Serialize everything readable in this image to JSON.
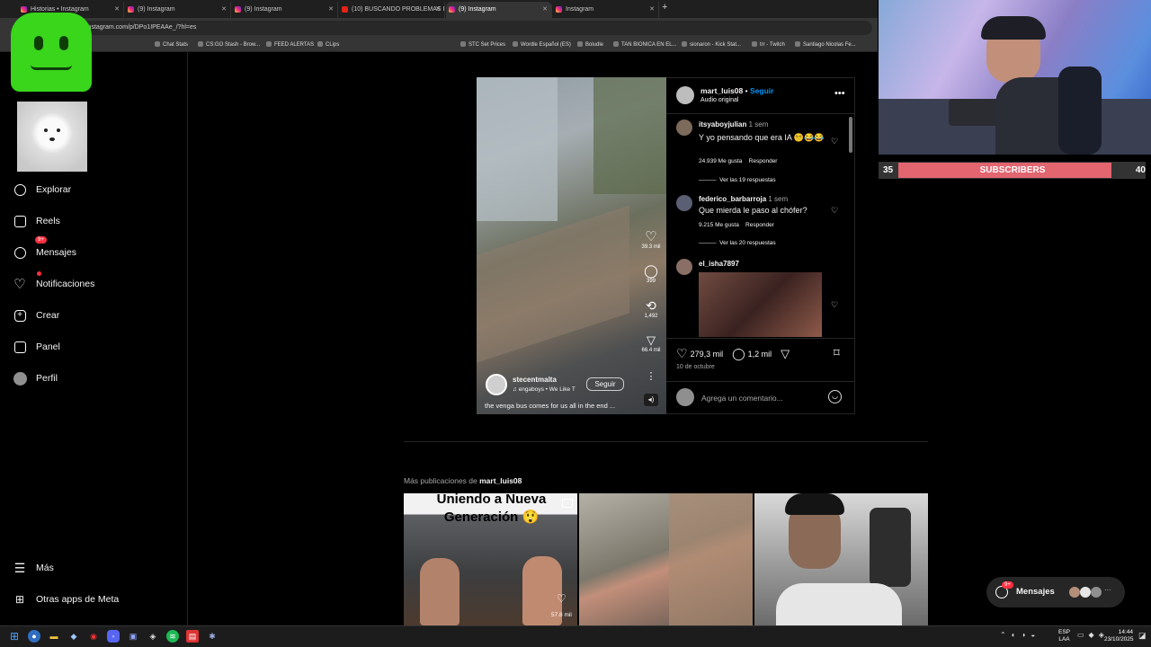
{
  "browser": {
    "tabs": [
      {
        "title": "Historias • Instagram",
        "fav": "ig"
      },
      {
        "title": "(9) Instagram",
        "fav": "ig"
      },
      {
        "title": "(9) Instagram",
        "fav": "ig"
      },
      {
        "title": "(10) BUSCANDO PROBLEMAS I",
        "fav": "yt"
      },
      {
        "title": "(9) Instagram",
        "fav": "ig"
      },
      {
        "title": "Instagram",
        "fav": "ig"
      }
    ],
    "url": "instagram.com/p/DPo1IPEAAe_/?hl=es",
    "bookmarks": [
      "Chat Stats",
      "CS:GO Stash - Brow...",
      "FEED ALERTAS",
      "CLips",
      "STC Set Prices",
      "Wordle Español (ES)",
      "Boludle",
      "TAN BIONICA EN EL...",
      "sionaron - Kick Stat...",
      "trr - Twitch",
      "Santiago Nicolas Fe..."
    ]
  },
  "sidebar": {
    "items": [
      {
        "label": "Explorar",
        "icon": "compass-icon"
      },
      {
        "label": "Reels",
        "icon": "reels-icon"
      },
      {
        "label": "Mensajes",
        "icon": "messenger-icon",
        "badge": "9+"
      },
      {
        "label": "Notificaciones",
        "icon": "heart-icon"
      },
      {
        "label": "Crear",
        "icon": "plus-square-icon"
      },
      {
        "label": "Panel",
        "icon": "chart-icon"
      },
      {
        "label": "Perfil",
        "icon": "avatar"
      }
    ],
    "more": "Más",
    "meta": "Otras apps de Meta"
  },
  "stream": {
    "sub_current": "35",
    "sub_label": "SUBSCRIBERS",
    "sub_goal": "40",
    "sub_progress": 0.875
  },
  "video": {
    "likes": "39.3 mil",
    "comments": "399",
    "reposts": "1,492",
    "shares": "66.4 mil",
    "author": "stecentmalta",
    "audio": "engaboys • We Like T",
    "follow": "Seguir",
    "caption": "the venga bus comes for us all in the end ..."
  },
  "post": {
    "username": "mart_luis08",
    "separator": "•",
    "follow": "Seguir",
    "audio": "Audio original",
    "comments": [
      {
        "user": "itsyaboyjulian",
        "time": "1 sem",
        "text": "Y yo pensando que era IA 😵‍💫😂😂",
        "likes": "24.939 Me gusta",
        "reply": "Responder",
        "replies": "Ver las 19 respuestas"
      },
      {
        "user": "federico_barbarroja",
        "time": "1 sem",
        "text": "Que mierda le paso al chófer?",
        "likes": "9.215 Me gusta",
        "reply": "Responder",
        "replies": "Ver las 20 respuestas"
      },
      {
        "user": "el_isha7897"
      }
    ],
    "like_count": "279,3 mil",
    "comment_count": "1,2 mil",
    "date": "10 de octubre",
    "add_comment_placeholder": "Agrega un comentario..."
  },
  "more_posts": {
    "prefix": "Más publicaciones de",
    "user": "mart_luis08",
    "thumb1_text": "Uniendo a Nueva Generación 😲",
    "thumb1_views": "57.8 mil"
  },
  "floating": {
    "messages": "Mensajes",
    "badge": "9+"
  },
  "taskbar": {
    "lang": "ESP",
    "lang2": "LAA",
    "time": "14:44",
    "date": "23/10/2025"
  }
}
